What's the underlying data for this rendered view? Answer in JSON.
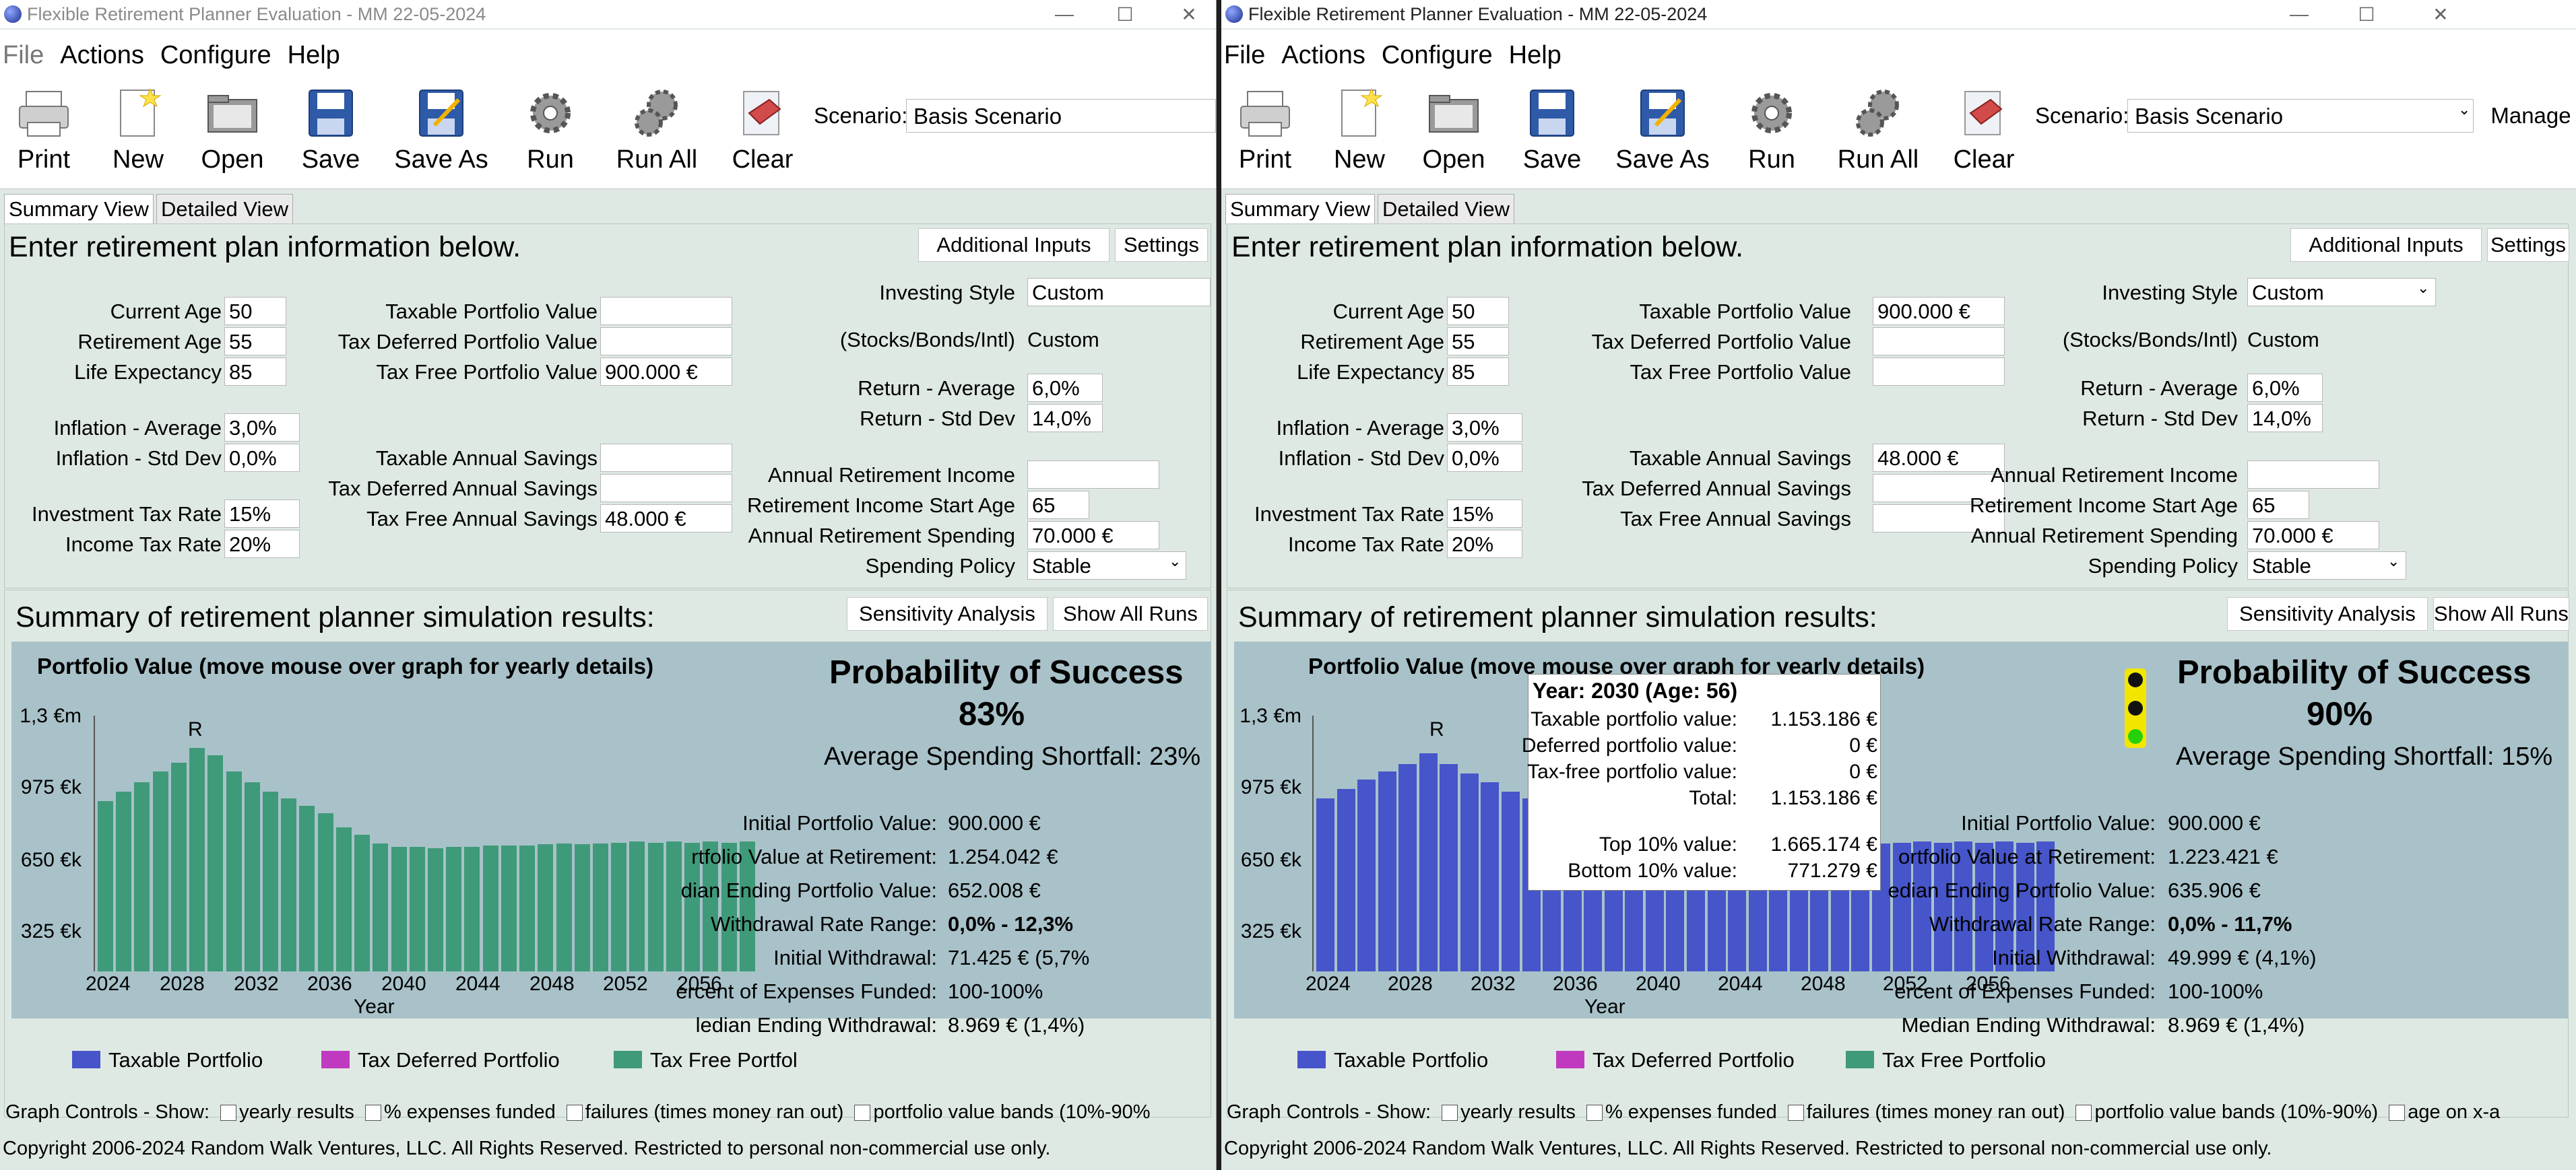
{
  "left": {
    "title": "Flexible Retirement Planner Evaluation - MM 22-05-2024",
    "menu": [
      "File",
      "Actions",
      "Configure",
      "Help"
    ],
    "toolbar": [
      "Print",
      "New",
      "Open",
      "Save",
      "Save As",
      "Run",
      "Run All",
      "Clear"
    ],
    "scenario_label": "Scenario:",
    "scenario_value": "Basis Scenario",
    "tabs": [
      "Summary View",
      "Detailed View"
    ],
    "enter_heading": "Enter retirement plan information below.",
    "btn_additional": "Additional Inputs",
    "btn_settings": "Settings",
    "inputs": {
      "current_age_label": "Current Age",
      "current_age": "50",
      "retirement_age_label": "Retirement Age",
      "retirement_age": "55",
      "life_exp_label": "Life Expectancy",
      "life_exp": "85",
      "infl_avg_label": "Inflation - Average",
      "infl_avg": "3,0%",
      "infl_std_label": "Inflation - Std Dev",
      "infl_std": "0,0%",
      "inv_tax_label": "Investment Tax Rate",
      "inv_tax": "15%",
      "inc_tax_label": "Income Tax Rate",
      "inc_tax": "20%",
      "taxable_pv_label": "Taxable Portfolio Value",
      "taxable_pv": "",
      "taxdef_pv_label": "Tax Deferred Portfolio Value",
      "taxdef_pv": "",
      "taxfree_pv_label": "Tax Free Portfolio Value",
      "taxfree_pv": "900.000 €",
      "taxable_sav_label": "Taxable Annual Savings",
      "taxable_sav": "",
      "taxdef_sav_label": "Tax Deferred Annual Savings",
      "taxdef_sav": "",
      "taxfree_sav_label": "Tax Free Annual Savings",
      "taxfree_sav": "48.000 €",
      "style_label": "Investing Style",
      "style": "Custom",
      "sbi_label": "(Stocks/Bonds/Intl)",
      "sbi": "Custom",
      "ret_avg_label": "Return - Average",
      "ret_avg": "6,0%",
      "ret_std_label": "Return - Std Dev",
      "ret_std": "14,0%",
      "ann_inc_label": "Annual Retirement Income",
      "ann_inc": "",
      "inc_start_label": "Retirement Income Start Age",
      "inc_start": "65",
      "ann_spend_label": "Annual Retirement Spending",
      "ann_spend": "70.000 €",
      "policy_label": "Spending Policy",
      "policy": "Stable"
    },
    "summary_heading": "Summary of retirement planner simulation results:",
    "btn_sensitivity": "Sensitivity Analysis",
    "btn_showall": "Show All Runs",
    "graph_title": "Portfolio Value  (move mouse over graph for yearly details)",
    "prob_title": "Probability of Success",
    "prob_value": "83%",
    "shortfall": "Average Spending Shortfall: 23%",
    "stats": [
      [
        "Initial Portfolio Value:",
        "900.000 €"
      ],
      [
        "rtfolio Value at Retirement:",
        "1.254.042 €"
      ],
      [
        "dian Ending Portfolio Value:",
        "652.008 €"
      ],
      [
        "Withdrawal Rate Range:",
        "0,0% - 12,3%"
      ],
      [
        "Initial Withdrawal:",
        "71.425 € (5,7%"
      ],
      [
        "ercent of Expenses Funded:",
        "100-100%"
      ],
      [
        "ledian Ending Withdrawal:",
        "8.969 € (1,4%)"
      ]
    ],
    "legend": [
      "Taxable Portfolio",
      "Tax Deferred Portfolio",
      "Tax Free Portfol"
    ],
    "graph_controls": [
      "Graph Controls - Show:",
      "yearly results",
      "% expenses funded",
      "failures (times money ran out)",
      "portfolio value bands (10%-90%"
    ],
    "copyright": "Copyright 2006-2024 Random Walk Ventures, LLC.  All Rights Reserved.   Restricted to personal non-commercial use only."
  },
  "right": {
    "title": "Flexible Retirement Planner Evaluation - MM 22-05-2024",
    "menu": [
      "File",
      "Actions",
      "Configure",
      "Help"
    ],
    "toolbar": [
      "Print",
      "New",
      "Open",
      "Save",
      "Save As",
      "Run",
      "Run All",
      "Clear"
    ],
    "scenario_label": "Scenario:",
    "scenario_value": "Basis Scenario",
    "manage_label": "Manage",
    "tabs": [
      "Summary View",
      "Detailed View"
    ],
    "enter_heading": "Enter retirement plan information below.",
    "btn_additional": "Additional Inputs",
    "btn_settings": "Settings",
    "inputs": {
      "current_age_label": "Current Age",
      "current_age": "50",
      "retirement_age_label": "Retirement Age",
      "retirement_age": "55",
      "life_exp_label": "Life Expectancy",
      "life_exp": "85",
      "infl_avg_label": "Inflation - Average",
      "infl_avg": "3,0%",
      "infl_std_label": "Inflation - Std Dev",
      "infl_std": "0,0%",
      "inv_tax_label": "Investment Tax Rate",
      "inv_tax": "15%",
      "inc_tax_label": "Income Tax Rate",
      "inc_tax": "20%",
      "taxable_pv_label": "Taxable Portfolio Value",
      "taxable_pv": "900.000 €",
      "taxdef_pv_label": "Tax Deferred Portfolio Value",
      "taxdef_pv": "",
      "taxfree_pv_label": "Tax Free Portfolio Value",
      "taxfree_pv": "",
      "taxable_sav_label": "Taxable Annual Savings",
      "taxable_sav": "48.000 €",
      "taxdef_sav_label": "Tax Deferred Annual Savings",
      "taxdef_sav": "",
      "taxfree_sav_label": "Tax Free Annual Savings",
      "taxfree_sav": "",
      "style_label": "Investing Style",
      "style": "Custom",
      "sbi_label": "(Stocks/Bonds/Intl)",
      "sbi": "Custom",
      "ret_avg_label": "Return - Average",
      "ret_avg": "6,0%",
      "ret_std_label": "Return - Std Dev",
      "ret_std": "14,0%",
      "ann_inc_label": "Annual Retirement Income",
      "ann_inc": "",
      "inc_start_label": "Retirement Income Start Age",
      "inc_start": "65",
      "ann_spend_label": "Annual Retirement Spending",
      "ann_spend": "70.000 €",
      "policy_label": "Spending Policy",
      "policy": "Stable"
    },
    "summary_heading": "Summary of retirement planner simulation results:",
    "btn_sensitivity": "Sensitivity Analysis",
    "btn_showall": "Show All Runs",
    "graph_title": "Portfolio Value  (move mouse over graph for yearly details)",
    "prob_title": "Probability of Success",
    "prob_value": "90%",
    "shortfall": "Average Spending Shortfall: 15%",
    "stats": [
      [
        "Initial Portfolio Value:",
        "900.000 €"
      ],
      [
        "ortfolio Value at Retirement:",
        "1.223.421 €"
      ],
      [
        "edian Ending Portfolio Value:",
        "635.906 €"
      ],
      [
        "Withdrawal Rate Range:",
        "0,0% - 11,7%"
      ],
      [
        "Initial Withdrawal:",
        "49.999 € (4,1%)"
      ],
      [
        "ercent of Expenses Funded:",
        "100-100%"
      ],
      [
        "Median Ending Withdrawal:",
        "8.969 € (1,4%)"
      ]
    ],
    "tooltip": {
      "header": "Year: 2030 (Age: 56)",
      "rows": [
        [
          "Taxable portfolio value:",
          "1.153.186 €"
        ],
        [
          "Deferred portfolio value:",
          "0 €"
        ],
        [
          "Tax-free portfolio value:",
          "0 €"
        ],
        [
          "Total:",
          "1.153.186 €"
        ],
        [
          "Top 10% value:",
          "1.665.174 €"
        ],
        [
          "Bottom 10% value:",
          "771.279 €"
        ]
      ]
    },
    "legend": [
      "Taxable Portfolio",
      "Tax Deferred Portfolio",
      "Tax Free Portfolio"
    ],
    "graph_controls": [
      "Graph Controls - Show:",
      "yearly results",
      "% expenses funded",
      "failures (times money ran out)",
      "portfolio value bands (10%-90%)",
      "age on x-a"
    ],
    "copyright": "Copyright 2006-2024 Random Walk Ventures, LLC.  All Rights Reserved.   Restricted to personal non-commercial use only."
  },
  "colors": {
    "taxable": "#4655c9",
    "tax_deferred": "#c03ac0",
    "tax_free": "#3f9a7a",
    "graph_bg": "#a9c2c9",
    "panel_bg": "#dfe9e3"
  },
  "chart_data": [
    {
      "type": "bar",
      "title": "Portfolio Value  (move mouse over graph for yearly details)",
      "xlabel": "Year",
      "ylabel": "",
      "y_ticks": [
        "325 €k",
        "650 €k",
        "975 €k",
        "1,3 €m"
      ],
      "x_ticks": [
        "2024",
        "2028",
        "2032",
        "2036",
        "2040",
        "2044",
        "2048",
        "2052",
        "2056"
      ],
      "marker": {
        "label": "R",
        "year": 2029
      },
      "series": [
        {
          "name": "Tax Free Portfolio",
          "color": "#3f9a7a"
        }
      ],
      "x": [
        2024,
        2025,
        2026,
        2027,
        2028,
        2029,
        2030,
        2031,
        2032,
        2033,
        2034,
        2035,
        2036,
        2037,
        2038,
        2039,
        2040,
        2041,
        2042,
        2043,
        2044,
        2045,
        2046,
        2047,
        2048,
        2049,
        2050,
        2051,
        2052,
        2053,
        2054,
        2055,
        2056,
        2057,
        2058,
        2059
      ],
      "values": [
        945,
        1000,
        1050,
        1110,
        1160,
        1240,
        1200,
        1110,
        1050,
        1000,
        960,
        920,
        880,
        800,
        760,
        710,
        690,
        690,
        685,
        690,
        690,
        700,
        700,
        700,
        705,
        710,
        705,
        710,
        715,
        720,
        715,
        720,
        715,
        720,
        715,
        720
      ]
    },
    {
      "type": "bar",
      "title": "Portfolio Value  (move mouse over graph for yearly details)",
      "xlabel": "Year",
      "ylabel": "",
      "y_ticks": [
        "325 €k",
        "650 €k",
        "975 €k",
        "1,3 €m"
      ],
      "x_ticks": [
        "2024",
        "2028",
        "2032",
        "2036",
        "2040",
        "2044",
        "2048",
        "2052",
        "2056"
      ],
      "marker": {
        "label": "R",
        "year": 2029
      },
      "series": [
        {
          "name": "Taxable Portfolio",
          "color": "#4655c9"
        }
      ],
      "x": [
        2024,
        2025,
        2026,
        2027,
        2028,
        2029,
        2030,
        2031,
        2032,
        2033,
        2034,
        2035,
        2036,
        2037,
        2038,
        2039,
        2040,
        2041,
        2042,
        2043,
        2044,
        2045,
        2046,
        2047,
        2048,
        2049,
        2050,
        2051,
        2052,
        2053,
        2054,
        2055,
        2056,
        2057,
        2058,
        2059
      ],
      "values": [
        960,
        1015,
        1065,
        1110,
        1150,
        1210,
        1153,
        1100,
        1050,
        1000,
        960,
        920,
        880,
        820,
        780,
        740,
        720,
        710,
        700,
        700,
        700,
        700,
        700,
        700,
        705,
        710,
        705,
        710,
        715,
        720,
        715,
        720,
        715,
        720,
        715,
        720
      ]
    }
  ]
}
